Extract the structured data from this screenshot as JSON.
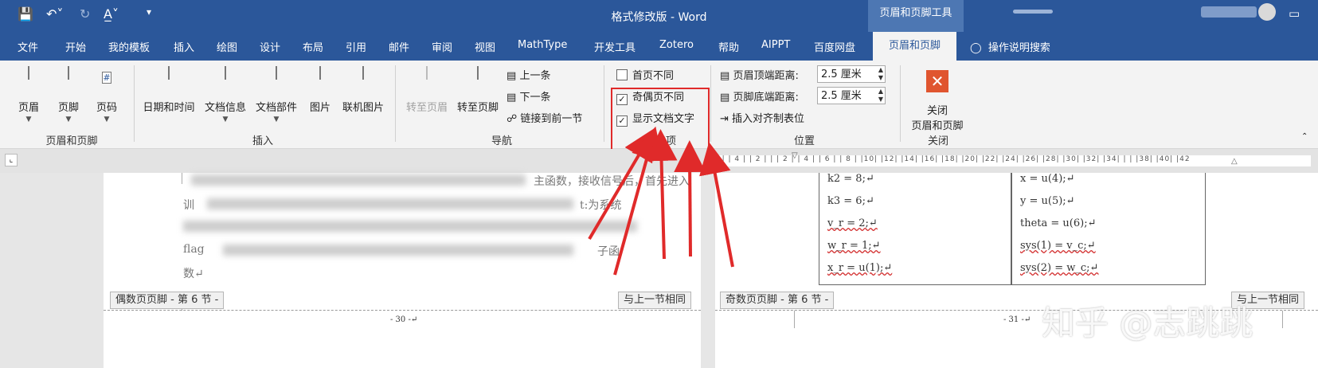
{
  "window": {
    "title": "格式修改版 - Word",
    "context_tab_header": "页眉和页脚工具"
  },
  "menu": {
    "tabs": [
      "文件",
      "开始",
      "我的模板",
      "插入",
      "绘图",
      "设计",
      "布局",
      "引用",
      "邮件",
      "审阅",
      "视图",
      "MathType",
      "开发工具",
      "Zotero",
      "帮助",
      "AIPPT",
      "百度网盘"
    ],
    "active_tab": "页眉和页脚",
    "tell_me": "操作说明搜索"
  },
  "ribbon": {
    "group_header_footer": {
      "label": "页眉和页脚",
      "buttons": [
        "页眉",
        "页脚",
        "页码"
      ]
    },
    "group_insert": {
      "label": "插入",
      "buttons": [
        "日期和时间",
        "文档信息",
        "文档部件",
        "图片",
        "联机图片"
      ]
    },
    "group_nav": {
      "label": "导航",
      "goto_header": "转至页眉",
      "goto_footer": "转至页脚",
      "prev": "上一条",
      "next": "下一条",
      "link_prev": "链接到前一节"
    },
    "group_options": {
      "label": "选项",
      "first_page": {
        "label": "首页不同",
        "checked": false
      },
      "odd_even": {
        "label": "奇偶页不同",
        "checked": true
      },
      "show_doc_text": {
        "label": "显示文档文字",
        "checked": true
      }
    },
    "group_position": {
      "label": "位置",
      "header_top_label": "页眉顶端距离:",
      "header_top_value": "2.5 厘米",
      "footer_bottom_label": "页脚底端距离:",
      "footer_bottom_value": "2.5 厘米",
      "insert_align_tab": "插入对齐制表位"
    },
    "group_close": {
      "label": "关闭",
      "button_line1": "关闭",
      "button_line2": "页眉和页脚"
    }
  },
  "ruler": {
    "text": "6 | | 4 | | 2 | | | 2 | | 4 | | 6 | | 8 | |10| |12| |14| |16| |18| |20| |22| |24| |26| |28| |30| |32| |34| | | |38| |40| |42"
  },
  "left_page": {
    "visible_text": {
      "frag1": "主函数，接收信号后，首先进入",
      "frag2": "t:为系统",
      "frag3": "子函",
      "frag4": "数↵",
      "frag5": "flag",
      "frag6": "训"
    },
    "footer_tag": "偶数页页脚 - 第 6 节 -",
    "same_as_prev": "与上一节相同",
    "page_number": "- 30 -↵"
  },
  "right_page": {
    "code_left": [
      "k2 = 8;↵",
      "k3 = 6;↵",
      "v_r = 2;↵",
      "w_r = 1;↵",
      "x_r = u(1);↵"
    ],
    "code_right": [
      "x = u(4);↵",
      "y = u(5);↵",
      "theta = u(6);↵",
      "sys(1) = v_c;↵",
      "sys(2) = w_c;↵"
    ],
    "footer_tag": "奇数页页脚 - 第 6 节 -",
    "same_as_prev": "与上一节相同",
    "page_number": "- 31 -↵"
  },
  "watermark": "知乎 @志跳跳",
  "colors": {
    "word_blue": "#2b579a",
    "annotation_red": "#e02a2a"
  }
}
